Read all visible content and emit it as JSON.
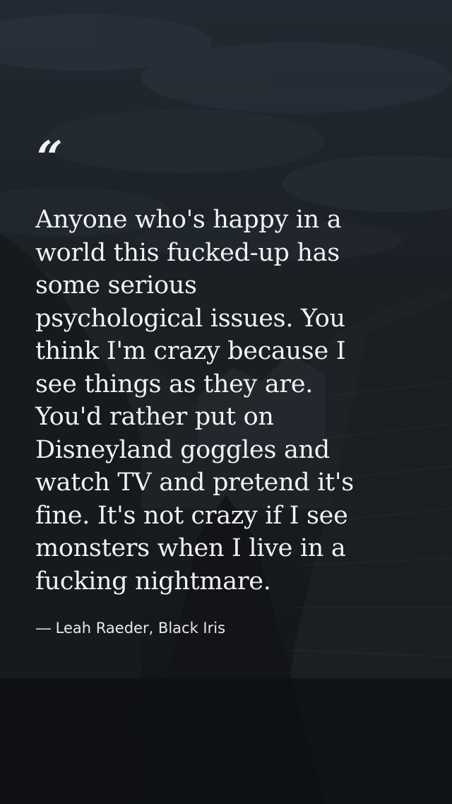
{
  "quote": {
    "mark": "“",
    "text": "Anyone who's happy in a\nworld this fucked-up has\nsome serious\npsychological issues. You\nthink I'm crazy because I\nsee things as they are.\nYou'd rather put on\nDisneyland goggles and\nwatch TV and pretend it's\nfine. It's not crazy if I see\nmonsters when I live in a\nfucking nightmare.",
    "attribution": "― Leah Raeder, Black Iris"
  }
}
